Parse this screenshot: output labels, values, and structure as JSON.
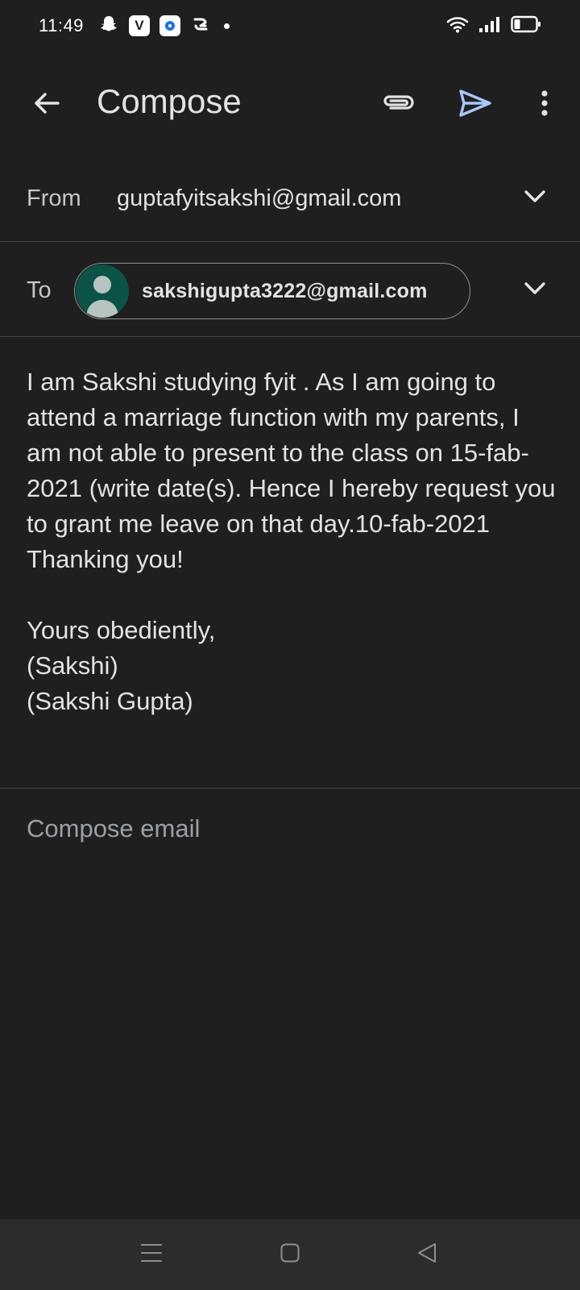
{
  "status_bar": {
    "time": "11:49",
    "app_icons": [
      "snapchat-icon",
      "vk-icon",
      "signal-icon",
      "sharechat-icon"
    ],
    "battery_level": 0.25
  },
  "toolbar": {
    "title": "Compose",
    "icons": [
      "back-arrow-icon",
      "paperclip-icon",
      "send-icon",
      "more-vert-icon"
    ],
    "send_color": "#a8c7fa"
  },
  "from": {
    "label": "From",
    "value": "guptafyitsakshi@gmail.com"
  },
  "to": {
    "label": "To",
    "chip_email": "sakshigupta3222@gmail.com",
    "avatar_color": "#0b5346"
  },
  "body": {
    "paragraph": "I am Sakshi  studying  fyit . As I am going to attend a marriage function with my parents, I am not able to present to the class on 15-fab-2021 (write date(s). Hence I hereby request you to grant me leave on that day.10-fab-2021 Thanking you!",
    "closing": "Yours obediently,",
    "signature_1": "(Sakshi)",
    "signature_2": "(Sakshi Gupta)"
  },
  "compose_placeholder": "Compose email",
  "nav_bar": {
    "icons": [
      "menu-icon",
      "home-icon",
      "back-icon"
    ]
  }
}
